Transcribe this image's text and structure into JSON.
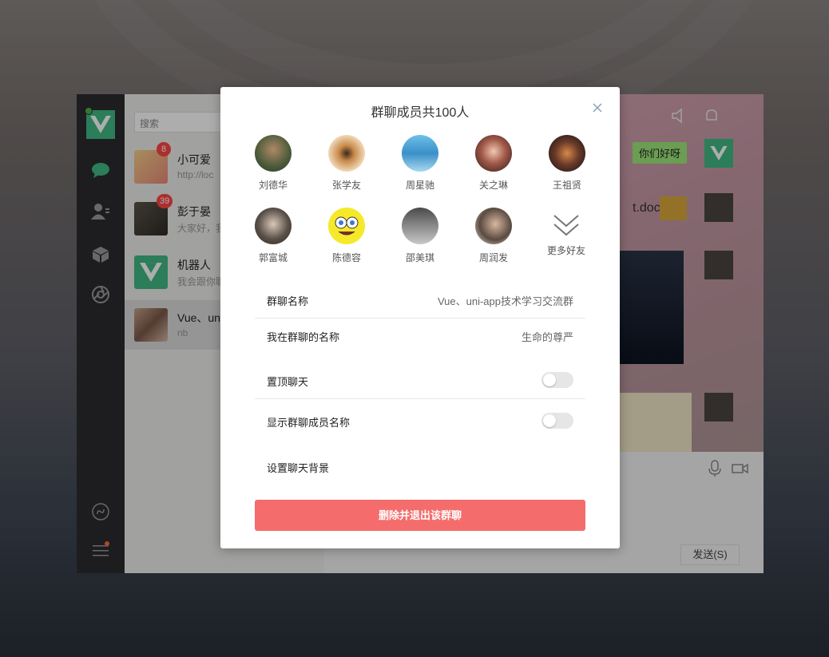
{
  "sidebar": {
    "logo_icon": "vue-logo-icon",
    "nav_icons": [
      "chat-bubble-icon",
      "contacts-icon",
      "cube-icon",
      "aperture-icon",
      "mini-program-icon",
      "menu-icon"
    ]
  },
  "conversations": {
    "search_placeholder": "搜索",
    "items": [
      {
        "name": "小可爱",
        "preview": "http://loc",
        "badge": "8"
      },
      {
        "name": "彭于晏",
        "preview": "大家好，我",
        "badge": "39"
      },
      {
        "name": "机器人",
        "preview": "我会跟你聊",
        "badge": ""
      },
      {
        "name": "Vue、un",
        "preview": "nb",
        "badge": ""
      }
    ]
  },
  "chat": {
    "bubble_text": "你们好呀",
    "file_name": "t.doc",
    "send_label": "发送(S)"
  },
  "dialog": {
    "title": "群聊成员共100人",
    "members": [
      "刘德华",
      "张学友",
      "周星驰",
      "关之琳",
      "王祖贤",
      "郭富城",
      "陈德容",
      "邵美琪",
      "周润发"
    ],
    "more_label": "更多好友",
    "group_name_label": "群聊名称",
    "group_name_value": "Vue、uni-app技术学习交流群",
    "my_nickname_label": "我在群聊的名称",
    "my_nickname_value": "生命的尊严",
    "pin_label": "置顶聊天",
    "pin_on": false,
    "show_names_label": "显示群聊成员名称",
    "show_names_on": false,
    "background_label": "设置聊天背景",
    "exit_button": "删除并退出该群聊"
  },
  "colors": {
    "accent": "#41b883",
    "danger": "#f46d6c",
    "badge": "#ff4444"
  }
}
